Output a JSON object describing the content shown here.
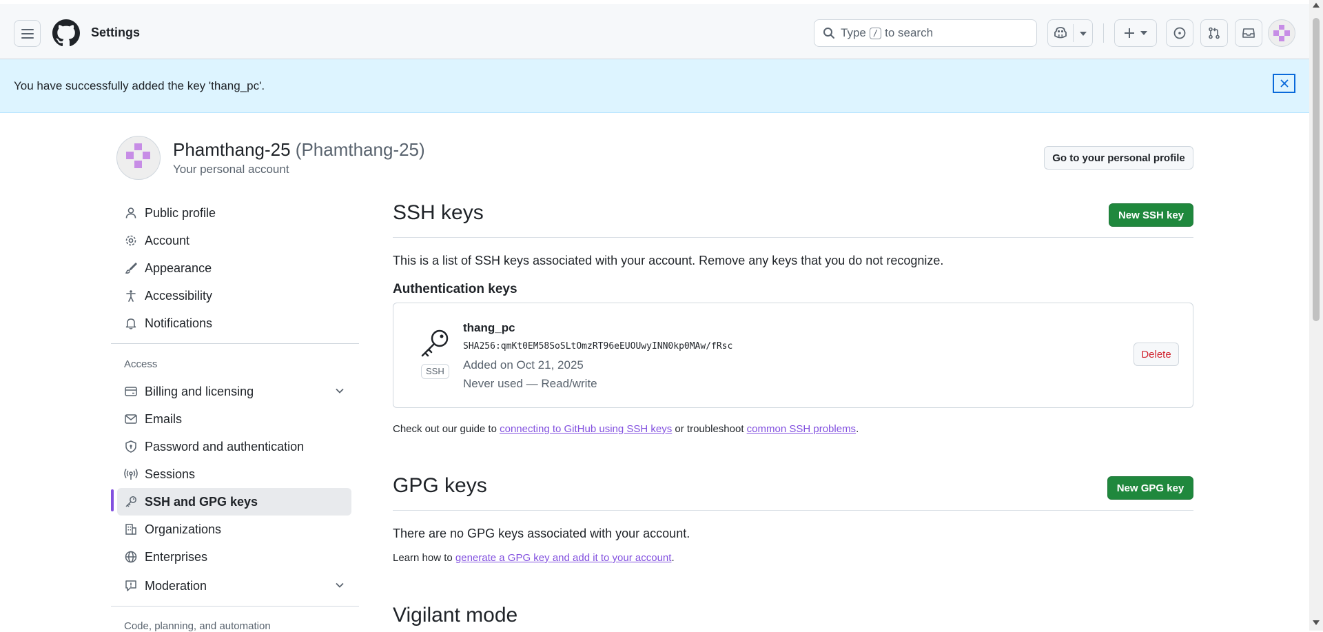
{
  "header": {
    "title": "Settings",
    "search_prefix": "Type",
    "search_key": "/",
    "search_suffix": "to search"
  },
  "flash": {
    "message": "You have successfully added the key 'thang_pc'."
  },
  "profile": {
    "name": "Phamthang-25",
    "login": "(Phamthang-25)",
    "subtitle": "Your personal account",
    "go_profile_label": "Go to your personal profile"
  },
  "sidebar": {
    "items": [
      {
        "label": "Public profile",
        "icon": "person-icon"
      },
      {
        "label": "Account",
        "icon": "gear-icon"
      },
      {
        "label": "Appearance",
        "icon": "paintbrush-icon"
      },
      {
        "label": "Accessibility",
        "icon": "accessibility-icon"
      },
      {
        "label": "Notifications",
        "icon": "bell-icon"
      }
    ],
    "access_heading": "Access",
    "access_items": [
      {
        "label": "Billing and licensing",
        "icon": "credit-card-icon"
      },
      {
        "label": "Emails",
        "icon": "mail-icon"
      },
      {
        "label": "Password and authentication",
        "icon": "shield-lock-icon"
      },
      {
        "label": "Sessions",
        "icon": "broadcast-icon"
      },
      {
        "label": "SSH and GPG keys",
        "icon": "key-icon"
      },
      {
        "label": "Organizations",
        "icon": "organization-icon"
      },
      {
        "label": "Enterprises",
        "icon": "globe-icon"
      },
      {
        "label": "Moderation",
        "icon": "report-icon"
      }
    ],
    "next_heading": "Code, planning, and automation"
  },
  "ssh": {
    "title": "SSH keys",
    "new_button": "New SSH key",
    "description": "This is a list of SSH keys associated with your account. Remove any keys that you do not recognize.",
    "auth_heading": "Authentication keys",
    "key": {
      "badge": "SSH",
      "name": "thang_pc",
      "fingerprint": "SHA256:qmKt0EM58SoSLtOmzRT96eEUOUwyINN0kp0MAw/fRsc",
      "added": "Added on Oct 21, 2025",
      "usage": "Never used — Read/write",
      "delete_label": "Delete"
    },
    "guide_prefix": "Check out our guide to",
    "guide_link": "connecting to GitHub using SSH keys",
    "guide_middle": "or troubleshoot",
    "guide_link2": "common SSH problems",
    "guide_suffix": "."
  },
  "gpg": {
    "title": "GPG keys",
    "new_button": "New GPG key",
    "empty_text": "There are no GPG keys associated with your account.",
    "learn_prefix": "Learn how to",
    "learn_link": "generate a GPG key and add it to your account",
    "learn_suffix": "."
  },
  "vigilant": {
    "title": "Vigilant mode"
  },
  "colors": {
    "accent_purple": "#8250df",
    "primary_green": "#1f883d",
    "flash_bg": "#ddf4ff",
    "danger_red": "#d1242f"
  }
}
